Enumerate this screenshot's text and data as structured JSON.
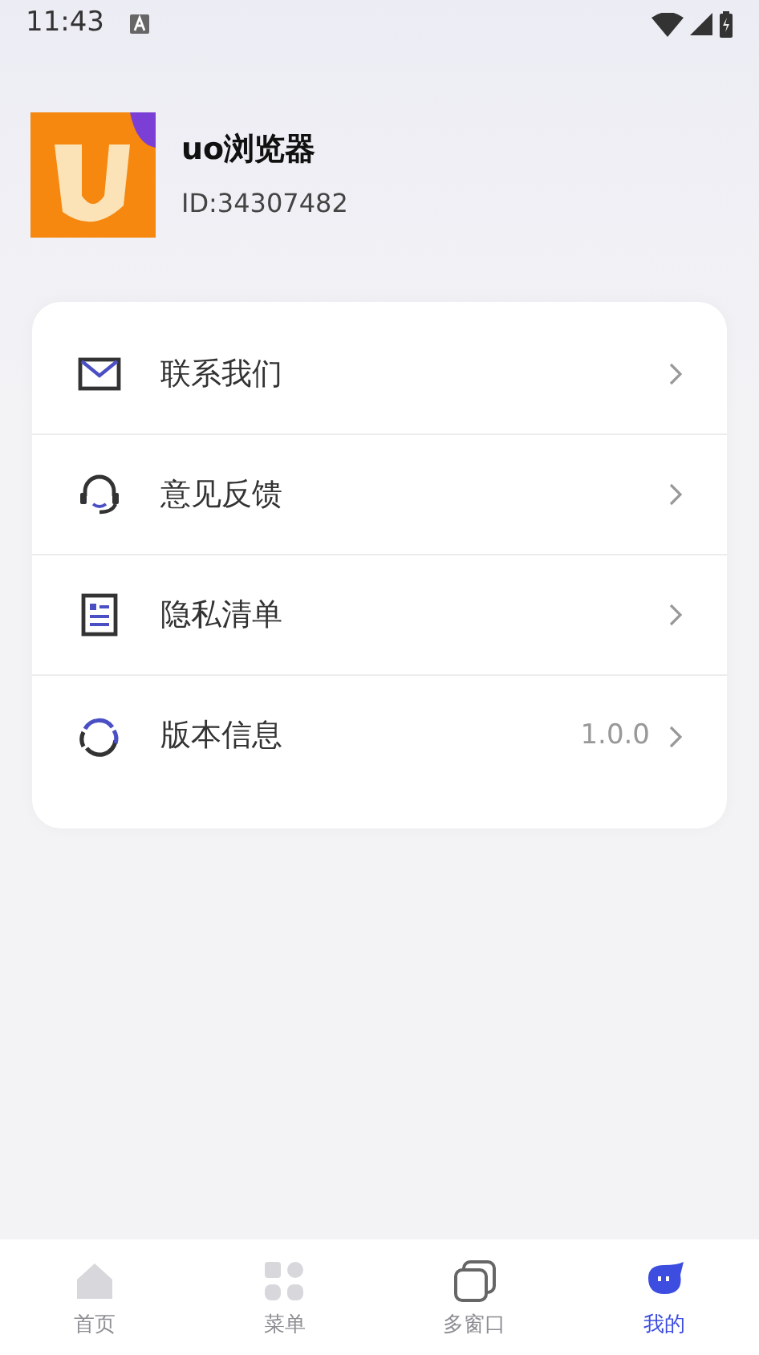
{
  "status_bar": {
    "time": "11:43"
  },
  "profile": {
    "name": "uo浏览器",
    "id": "ID:34307482"
  },
  "menu": [
    {
      "kind": "mail",
      "label": "联系我们"
    },
    {
      "kind": "headset",
      "label": "意见反馈"
    },
    {
      "kind": "list",
      "label": "隐私清单"
    },
    {
      "kind": "refresh",
      "label": "版本信息",
      "value": "1.0.0"
    }
  ],
  "tabs": [
    {
      "kind": "home",
      "label": "首页",
      "selected": false
    },
    {
      "kind": "grid",
      "label": "菜单",
      "selected": false
    },
    {
      "kind": "windows",
      "label": "多窗口",
      "selected": false
    },
    {
      "kind": "me",
      "label": "我的",
      "selected": true
    }
  ]
}
